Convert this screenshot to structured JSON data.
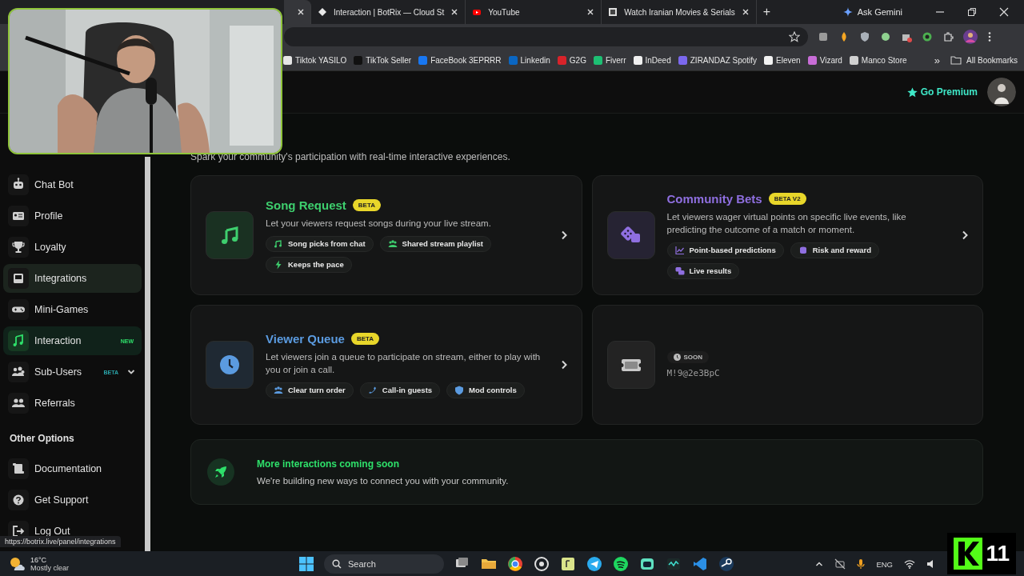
{
  "browser": {
    "tabs": [
      {
        "selected": true
      },
      {
        "title": "Interaction | BotRix — Cloud St",
        "selected": false
      },
      {
        "title": "YouTube",
        "selected": false
      },
      {
        "title": "Watch Iranian Movies & Serials",
        "selected": false
      }
    ],
    "new_tab": "+",
    "gemini": "Ask Gemini",
    "bookmarks": [
      {
        "label": "Tiktok YASILO",
        "color": "#e6e6e6"
      },
      {
        "label": "TikTok Seller",
        "color": "#111111"
      },
      {
        "label": "FaceBook 3EPRRR",
        "color": "#1877f2"
      },
      {
        "label": "Linkedin",
        "color": "#0a66c2"
      },
      {
        "label": "G2G",
        "color": "#d8232a"
      },
      {
        "label": "Fiverr",
        "color": "#1dbf73"
      },
      {
        "label": "InDeed",
        "color": "#f0f0f0"
      },
      {
        "label": "ZIRANDAZ Spotify",
        "color": "#7b68ee"
      },
      {
        "label": "Eleven",
        "color": "#f2f2f2"
      },
      {
        "label": "Vizard",
        "color": "#c86dd7"
      },
      {
        "label": "Manco Store",
        "color": "#d0d0d0"
      }
    ],
    "more_bookmarks": "»",
    "all_bookmarks": "All Bookmarks"
  },
  "header": {
    "premium": "Go Premium"
  },
  "sidebar": {
    "items": [
      {
        "label": "Chat Bot",
        "selected": false,
        "hovered": false
      },
      {
        "label": "Profile",
        "selected": false,
        "hovered": false
      },
      {
        "label": "Loyalty",
        "selected": false,
        "hovered": false
      },
      {
        "label": "Integrations",
        "selected": false,
        "hovered": true
      },
      {
        "label": "Mini-Games",
        "selected": false,
        "hovered": false
      },
      {
        "label": "Interaction",
        "selected": true,
        "hovered": false,
        "badge": "NEW",
        "color": "#2ee06a"
      },
      {
        "label": "Sub-Users",
        "selected": false,
        "hovered": false,
        "badge": "BETA",
        "color": "#2aa3a8",
        "expandable": true
      },
      {
        "label": "Referrals",
        "selected": false,
        "hovered": false
      }
    ],
    "section": "Other Options",
    "other_items": [
      {
        "label": "Documentation",
        "selected": false,
        "hovered": false
      },
      {
        "label": "Get Support",
        "selected": false,
        "hovered": false
      },
      {
        "label": "Log Out",
        "selected": false,
        "hovered": false
      }
    ]
  },
  "subtitle": "Spark your community's participation with real-time interactive experiences.",
  "cards": [
    {
      "kind": "feature",
      "title": "Song Request",
      "badge": "BETA",
      "color": "#3ecf6e",
      "description": "Let your viewers request songs during your live stream.",
      "chips": [
        "Song picks from chat",
        "Shared stream playlist",
        "Keeps the pace"
      ]
    },
    {
      "kind": "feature",
      "title": "Community Bets",
      "badge": "BETA V2",
      "color": "#8f6fe0",
      "description": "Let viewers wager virtual points on specific live events, like predicting the outcome of a match or moment.",
      "chips": [
        "Point-based predictions",
        "Risk and reward",
        "Live results"
      ]
    },
    {
      "kind": "feature",
      "title": "Viewer Queue",
      "badge": "BETA",
      "color": "#5b9be0",
      "description": "Let viewers join a queue to participate on stream, either to play with you or join a call.",
      "chips": [
        "Clear turn order",
        "Call-in guests",
        "Mod controls"
      ]
    },
    {
      "kind": "soon",
      "badge": "SOON",
      "code": "M!9@2e3BpC"
    }
  ],
  "banner": {
    "title": "More interactions coming soon",
    "text": "We're building new ways to connect you with your community."
  },
  "status_url": "https://botrix.live/panel/integrations",
  "taskbar": {
    "temperature": "16°C",
    "weather": "Mostly clear",
    "search": "Search",
    "language": "ENG"
  },
  "stream_logo": {
    "number": "11"
  }
}
